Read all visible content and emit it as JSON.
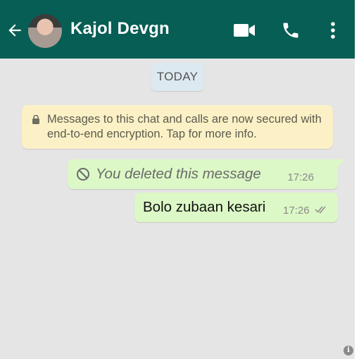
{
  "header": {
    "contact_name": "Kajol Devgn",
    "color": "#075e54",
    "icons": [
      "back-arrow-icon",
      "video-call-icon",
      "voice-call-icon",
      "more-options-icon"
    ]
  },
  "chat": {
    "date_chip": "TODAY",
    "encryption_notice": "Messages to this chat and calls are now secured with end-to-end encryption. Tap for more info.",
    "messages": [
      {
        "type": "deleted",
        "text": "You deleted this message",
        "time": "17:26"
      },
      {
        "type": "outgoing",
        "text": "Bolo zubaan kesari",
        "time": "17:26",
        "status": "read-ticks"
      }
    ],
    "bubble_color": "#dcf8c6",
    "notice_color": "#fcf1c6",
    "background": "#e5e5e5"
  },
  "info_icon": "i"
}
